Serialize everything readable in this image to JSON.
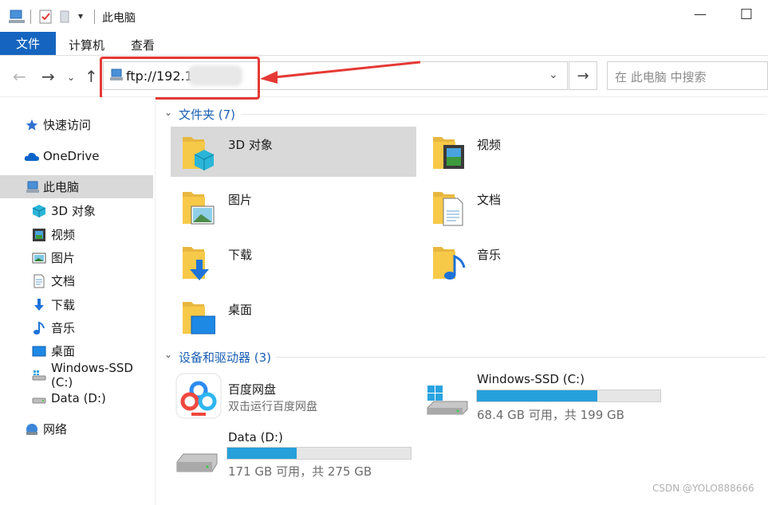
{
  "window": {
    "title": "此电脑",
    "controls": {
      "minimize": "—",
      "maximize": "☐"
    }
  },
  "ribbon": {
    "tabs": [
      "文件",
      "计算机",
      "查看"
    ]
  },
  "nav": {
    "address": "ftp://192.1",
    "search_placeholder": "在 此电脑 中搜索"
  },
  "sidebar": {
    "items": [
      {
        "label": "快速访问",
        "icon": "star-icon"
      },
      {
        "label": "OneDrive",
        "icon": "cloud-icon"
      },
      {
        "label": "此电脑",
        "icon": "computer-icon",
        "selected": true
      },
      {
        "label": "3D 对象",
        "icon": "cube-icon"
      },
      {
        "label": "视频",
        "icon": "video-icon"
      },
      {
        "label": "图片",
        "icon": "picture-icon"
      },
      {
        "label": "文档",
        "icon": "document-icon"
      },
      {
        "label": "下载",
        "icon": "download-icon"
      },
      {
        "label": "音乐",
        "icon": "music-icon"
      },
      {
        "label": "桌面",
        "icon": "desktop-icon"
      },
      {
        "label": "Windows-SSD (C:)",
        "icon": "drive-icon"
      },
      {
        "label": "Data (D:)",
        "icon": "drive-icon"
      },
      {
        "label": "网络",
        "icon": "network-icon"
      }
    ]
  },
  "main": {
    "folders_header": "文件夹 (7)",
    "folders": [
      {
        "label": "3D 对象",
        "icon": "cube-folder-icon"
      },
      {
        "label": "视频",
        "icon": "video-folder-icon"
      },
      {
        "label": "图片",
        "icon": "picture-folder-icon"
      },
      {
        "label": "文档",
        "icon": "document-folder-icon"
      },
      {
        "label": "下载",
        "icon": "download-folder-icon"
      },
      {
        "label": "音乐",
        "icon": "music-folder-icon"
      },
      {
        "label": "桌面",
        "icon": "desktop-folder-icon"
      }
    ],
    "devices_header": "设备和驱动器 (3)",
    "baidu": {
      "name": "百度网盘",
      "sub": "双击运行百度网盘"
    },
    "drives": [
      {
        "name": "Windows-SSD (C:)",
        "sub": "68.4 GB 可用，共 199 GB",
        "used_fraction": 0.656
      },
      {
        "name": "Data (D:)",
        "sub": "171 GB 可用，共 275 GB",
        "used_fraction": 0.378
      }
    ]
  },
  "watermark": "CSDN @YOLO888666",
  "colors": {
    "accent": "#1565c0",
    "drive_bar": "#26a0da",
    "annotation": "#e53935",
    "folder": "#f7c948"
  }
}
